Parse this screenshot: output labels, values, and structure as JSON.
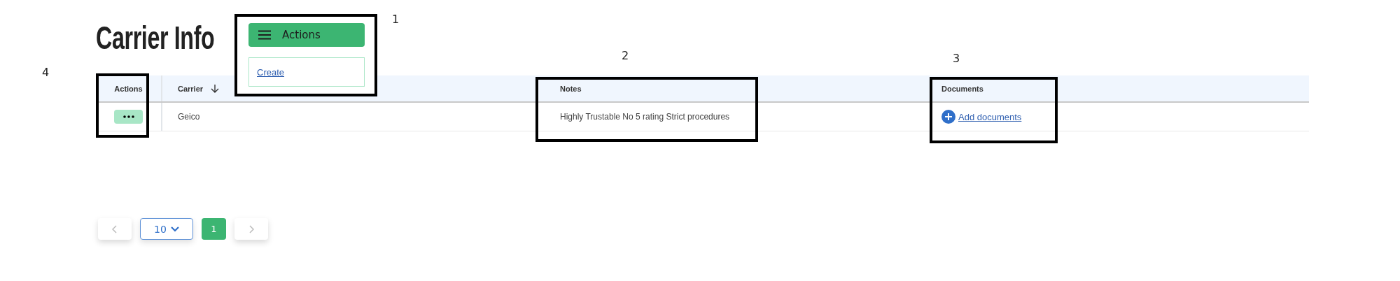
{
  "page": {
    "title": "Carrier Info"
  },
  "actions_menu": {
    "button": "Actions",
    "items": [
      {
        "label": "Create"
      }
    ]
  },
  "table": {
    "columns": [
      {
        "label": "Actions",
        "sorted": false
      },
      {
        "label": "Carrier",
        "sorted": true
      },
      {
        "label": "Notes",
        "sorted": false
      },
      {
        "label": "Documents",
        "sorted": false
      }
    ],
    "rows": [
      {
        "carrier": "Geico",
        "notes": "Highly Trustable No 5 rating Strict procedures",
        "documents_link": "Add documents"
      }
    ]
  },
  "pagination": {
    "page_size": "10",
    "pages": [
      {
        "label": "1",
        "selected": true
      }
    ]
  },
  "annotations": [
    {
      "label": "1"
    },
    {
      "label": "2"
    },
    {
      "label": "3"
    },
    {
      "label": "4"
    }
  ]
}
